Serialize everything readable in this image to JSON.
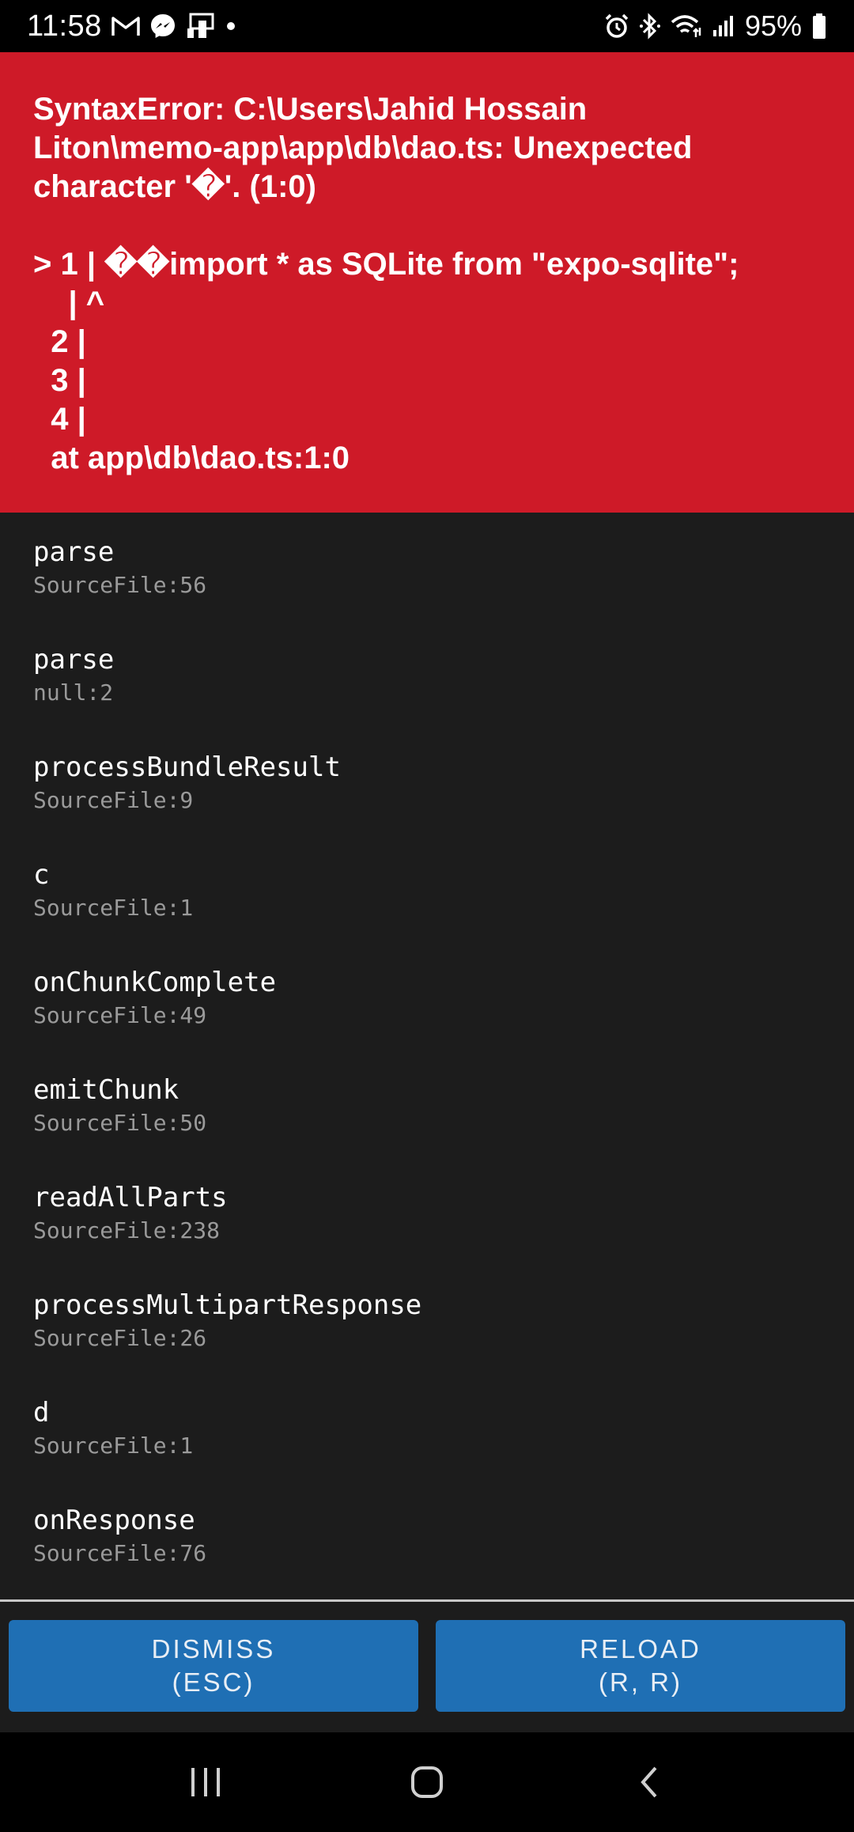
{
  "status_bar": {
    "time": "11:58",
    "battery_percent": "95%",
    "left_icons": [
      "gmail-icon",
      "messenger-icon",
      "notification-app-icon",
      "dot-icon"
    ],
    "right_icons": [
      "alarm-icon",
      "bluetooth-icon",
      "wifi-icon",
      "signal-icon",
      "battery-icon"
    ]
  },
  "error": {
    "title": "SyntaxError: C:\\Users\\Jahid Hossain\nLiton\\memo-app\\app\\db\\dao.ts: Unexpected\ncharacter '�'. (1:0)",
    "code_frame": "> 1 | ��import * as SQLite from \"expo-sqlite\";\n    | ^\n  2 |\n  3 |\n  4 |\n  at app\\db\\dao.ts:1:0",
    "background_color": "#ce1a28"
  },
  "stack": [
    {
      "method": "parse",
      "file": "SourceFile:56"
    },
    {
      "method": "parse",
      "file": "null:2"
    },
    {
      "method": "processBundleResult",
      "file": "SourceFile:9"
    },
    {
      "method": "c",
      "file": "SourceFile:1"
    },
    {
      "method": "onChunkComplete",
      "file": "SourceFile:49"
    },
    {
      "method": "emitChunk",
      "file": "SourceFile:50"
    },
    {
      "method": "readAllParts",
      "file": "SourceFile:238"
    },
    {
      "method": "processMultipartResponse",
      "file": "SourceFile:26"
    },
    {
      "method": "d",
      "file": "SourceFile:1"
    },
    {
      "method": "onResponse",
      "file": "SourceFile:76"
    }
  ],
  "buttons": {
    "dismiss_label": "DISMISS",
    "dismiss_shortcut": "(ESC)",
    "reload_label": "RELOAD",
    "reload_shortcut": "(R, R)",
    "button_color": "#1f6fb4"
  },
  "nav_bar": {
    "icons": [
      "recent-apps-icon",
      "home-icon",
      "back-icon"
    ]
  }
}
